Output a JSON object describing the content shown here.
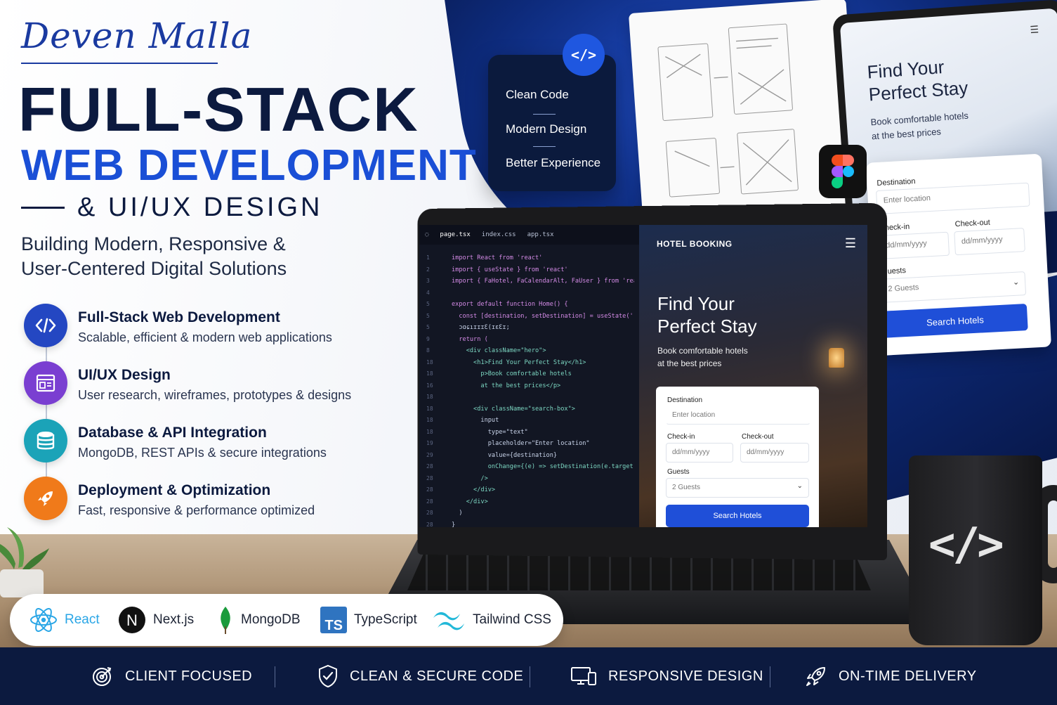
{
  "brand": {
    "signature": "Deven Malla"
  },
  "hero": {
    "title_line1": "FULL-STACK",
    "title_line2": "WEB DEVELOPMENT",
    "title_line3": "& UI/UX DESIGN",
    "subtitle_line1": "Building Modern, Responsive &",
    "subtitle_line2": "User-Centered Digital Solutions"
  },
  "features": [
    {
      "title": "Full-Stack Web Development",
      "desc": "Scalable, efficient & modern web applications",
      "icon": "code-icon",
      "color": "#2447c2"
    },
    {
      "title": "UI/UX Design",
      "desc": "User research, wireframes, prototypes & designs",
      "icon": "layout-icon",
      "color": "#7a3fd1"
    },
    {
      "title": "Database & API Integration",
      "desc": "MongoDB, REST APIs & secure integrations",
      "icon": "database-icon",
      "color": "#1ba3b8"
    },
    {
      "title": "Deployment & Optimization",
      "desc": "Fast, responsive & performance optimized",
      "icon": "rocket-icon",
      "color": "#f07a1a"
    }
  ],
  "code_card": {
    "badge": "</>",
    "items": [
      "Clean Code",
      "Modern Design",
      "Better Experience"
    ]
  },
  "tablet": {
    "title_line1": "Find Your",
    "title_line2": "Perfect Stay",
    "sub_line1": "Book comfortable hotels",
    "sub_line2": "at the best prices"
  },
  "float_form": {
    "destination_label": "Destination",
    "destination_placeholder": "Enter location",
    "checkin_label": "Check-in",
    "checkin_placeholder": "dd/mm/yyyy",
    "checkout_label": "Check-out",
    "checkout_placeholder": "dd/mm/yyyy",
    "guests_label": "Guests",
    "guests_value": "2 Guests",
    "button": "Search Hotels"
  },
  "editor": {
    "tabs": [
      "page.tsx",
      "index.css",
      "app.tsx"
    ],
    "line_numbers": [
      "1",
      "2",
      "3",
      "4",
      "5",
      "5",
      "5",
      "9",
      "8",
      "18",
      "18",
      "16",
      "18",
      "18",
      "18",
      "18",
      "19",
      "29",
      "28",
      "28",
      "28",
      "28",
      "28",
      "28"
    ],
    "lines": [
      "import React from 'react'",
      "import { useState } from 'react'",
      "import { FaHotel, FaCalendarAlt, FaUser } from 'react-icons/fa'",
      "",
      "export default function Home() {",
      "  const [destination, setDestination] = useState('')",
      "  ɔɑɕıɪɪɪƐ(ɪɛƐɪ;",
      "  return (",
      "    <div className=\"hero\">",
      "      <h1>Find Your Perfect Stay</h1>",
      "        p>Book comfortable hotels",
      "        at the best prices</p>",
      "",
      "      <div className=\"search-box\">",
      "        input",
      "          type=\"text\"",
      "          placeholder=\"Enter location\"",
      "          value={destination}",
      "          onChange={(e) => setDestination(e.target.value)}",
      "        />",
      "      </div>",
      "    </div>",
      "  )",
      "}"
    ]
  },
  "site": {
    "header": "HOTEL BOOKING",
    "title_line1": "Find Your",
    "title_line2": "Perfect Stay",
    "sub_line1": "Book comfortable hotels",
    "sub_line2": "at the best prices",
    "form": {
      "destination_label": "Destination",
      "destination_placeholder": "Enter location",
      "checkin_label": "Check-in",
      "checkin_placeholder": "dd/mm/yyyy",
      "checkout_label": "Check-out",
      "checkout_placeholder": "dd/mm/yyyy",
      "guests_label": "Guests",
      "guests_value": "2 Guests",
      "button": "Search Hotels"
    }
  },
  "mug": {
    "logo": "</>"
  },
  "tech": [
    {
      "label": "React",
      "icon": "react-icon",
      "color": "#2aa6e6"
    },
    {
      "label": "Next.js",
      "icon": "nextjs-icon",
      "color": "#111111"
    },
    {
      "label": "MongoDB",
      "icon": "mongodb-icon",
      "color": "#1a9b3c"
    },
    {
      "label": "TypeScript",
      "icon": "typescript-icon",
      "color": "#2f74c0",
      "badge": "TS"
    },
    {
      "label": "Tailwind CSS",
      "icon": "tailwind-icon",
      "color": "#22b8d8"
    }
  ],
  "bottom_bar": [
    {
      "label": "CLIENT FOCUSED",
      "icon": "target-icon"
    },
    {
      "label": "CLEAN & SECURE CODE",
      "icon": "shield-check-icon"
    },
    {
      "label": "RESPONSIVE DESIGN",
      "icon": "devices-icon"
    },
    {
      "label": "ON-TIME DELIVERY",
      "icon": "rocket-icon"
    }
  ],
  "colors": {
    "navy": "#0c1a3f",
    "accent_blue": "#1a4fd6"
  }
}
